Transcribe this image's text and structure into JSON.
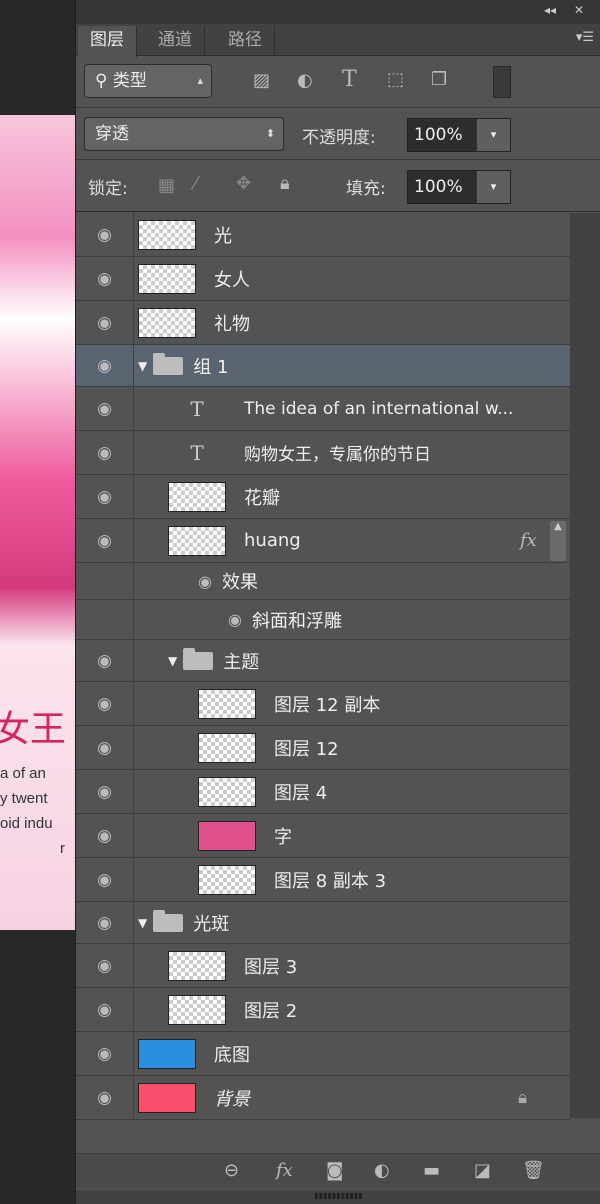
{
  "canvas": {
    "text_big": "女王",
    "lines": [
      "a of an",
      "y twent",
      "oid indu",
      "r"
    ]
  },
  "titlebar": {
    "collapse": "◂◂",
    "close": "✕"
  },
  "tabs": [
    {
      "label": "图层",
      "active": true
    },
    {
      "label": "通道"
    },
    {
      "label": "路径"
    }
  ],
  "filter": {
    "kind": "类型"
  },
  "blend": {
    "mode": "穿透",
    "opacity_label": "不透明度:",
    "opacity": "100%"
  },
  "lock": {
    "label": "锁定:",
    "fill_label": "填充:",
    "fill": "100%"
  },
  "layers": [
    {
      "type": "layer",
      "name": "光",
      "level": 0
    },
    {
      "type": "layer",
      "name": "女人",
      "level": 0
    },
    {
      "type": "layer",
      "name": "礼物",
      "level": 0
    },
    {
      "type": "group",
      "name": "组 1",
      "level": 0,
      "selected": true,
      "expanded": true
    },
    {
      "type": "text",
      "name": "The idea of an international w...",
      "level": 1
    },
    {
      "type": "text",
      "name": "购物女王，专属你的节日",
      "level": 1
    },
    {
      "type": "layer",
      "name": "花瓣",
      "level": 1
    },
    {
      "type": "layer",
      "name": "huang",
      "level": 1,
      "fx": "fx"
    },
    {
      "type": "effects",
      "name": "效果",
      "level": 1
    },
    {
      "type": "effect",
      "name": "斜面和浮雕",
      "level": 1
    },
    {
      "type": "group",
      "name": "主题",
      "level": 1,
      "expanded": true
    },
    {
      "type": "layer",
      "name": "图层 12 副本",
      "level": 2
    },
    {
      "type": "layer",
      "name": "图层 12",
      "level": 2
    },
    {
      "type": "layer",
      "name": "图层 4",
      "level": 2
    },
    {
      "type": "layer",
      "name": "字",
      "level": 2,
      "thumb_color": "#e0508a"
    },
    {
      "type": "layer",
      "name": "图层 8 副本 3",
      "level": 2
    },
    {
      "type": "group",
      "name": "光斑",
      "level": 0,
      "expanded": true
    },
    {
      "type": "layer",
      "name": "图层 3",
      "level": 1
    },
    {
      "type": "layer",
      "name": "图层 2",
      "level": 1
    },
    {
      "type": "layer",
      "name": "底图",
      "level": 0,
      "thumb_color": "#2a8fe0"
    },
    {
      "type": "layer",
      "name": "背景",
      "level": 0,
      "thumb_color": "#f8506a",
      "locked": true,
      "italic": true
    }
  ],
  "colors": {
    "selected": "#5a6370",
    "panel": "#535353"
  }
}
